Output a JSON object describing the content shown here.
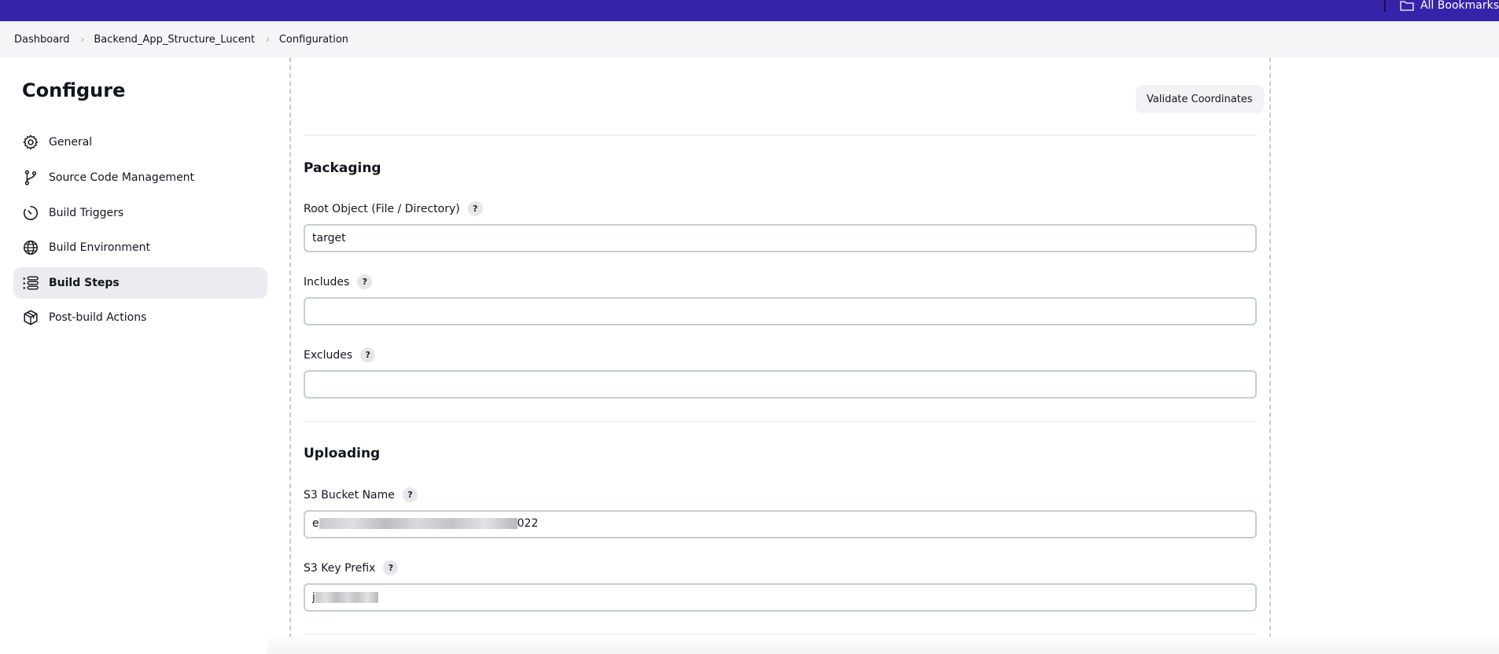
{
  "browser": {
    "bookmarks_label": "All Bookmarks",
    "bookmarks_icon": "folder-icon"
  },
  "breadcrumb": [
    "Dashboard",
    "Backend_App_Structure_Lucent",
    "Configuration"
  ],
  "sidebar": {
    "title": "Configure",
    "items": [
      {
        "label": "General",
        "icon": "gear-icon",
        "active": false
      },
      {
        "label": "Source Code Management",
        "icon": "branch-icon",
        "active": false
      },
      {
        "label": "Build Triggers",
        "icon": "timer-icon",
        "active": false
      },
      {
        "label": "Build Environment",
        "icon": "globe-icon",
        "active": false
      },
      {
        "label": "Build Steps",
        "icon": "list-steps-icon",
        "active": true
      },
      {
        "label": "Post-build Actions",
        "icon": "package-icon",
        "active": false
      }
    ]
  },
  "main": {
    "validate_button": "Validate Coordinates",
    "packaging": {
      "title": "Packaging",
      "root_object_label": "Root Object (File / Directory)",
      "root_object_value": "target",
      "includes_label": "Includes",
      "includes_value": "",
      "excludes_label": "Excludes",
      "excludes_value": ""
    },
    "uploading": {
      "title": "Uploading",
      "bucket_label": "S3 Bucket Name",
      "bucket_value_visible_start": "e",
      "bucket_value_visible_end": "022",
      "key_prefix_label": "S3 Key Prefix",
      "key_prefix_visible_start": "j"
    },
    "help_symbol": "?"
  }
}
